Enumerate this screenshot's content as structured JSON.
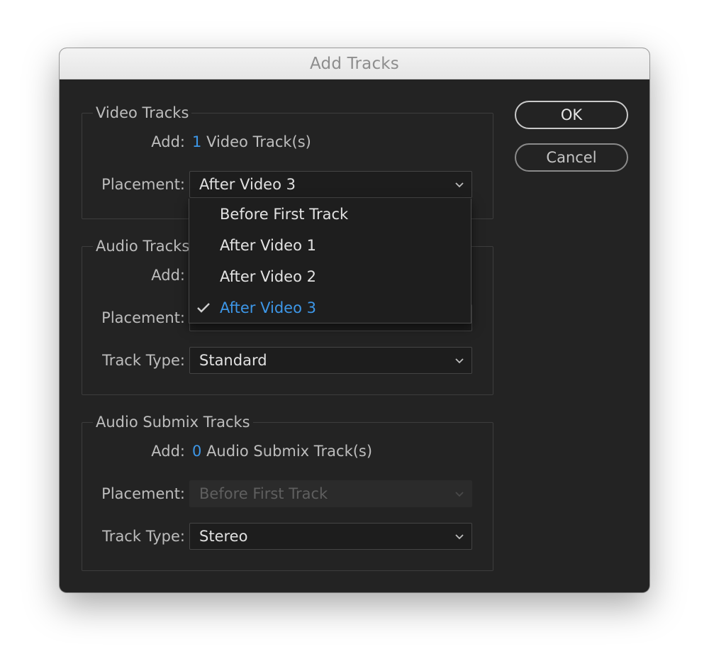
{
  "window": {
    "title": "Add Tracks"
  },
  "video": {
    "legend": "Video Tracks",
    "add_label": "Add:",
    "add_count": "1",
    "add_unit": "Video Track(s)",
    "placement_label": "Placement:",
    "placement_value": "After Video 3"
  },
  "audio": {
    "legend": "Audio Tracks",
    "add_label": "Add:",
    "placement_label": "Placement:",
    "track_type_label": "Track Type:",
    "track_type_value": "Standard"
  },
  "submix": {
    "legend": "Audio Submix Tracks",
    "add_label": "Add:",
    "add_count": "0",
    "add_unit": "Audio Submix Track(s)",
    "placement_label": "Placement:",
    "placement_value": "Before First Track",
    "placement_disabled": true,
    "track_type_label": "Track Type:",
    "track_type_value": "Stereo"
  },
  "buttons": {
    "ok": "OK",
    "cancel": "Cancel"
  },
  "dropdown": {
    "items": [
      {
        "label": "Before First Track",
        "selected": false
      },
      {
        "label": "After Video 1",
        "selected": false
      },
      {
        "label": "After Video 2",
        "selected": false
      },
      {
        "label": "After Video 3",
        "selected": true
      }
    ]
  },
  "colors": {
    "accent": "#3d97e8",
    "dialog_bg": "#232323",
    "text": "#bdbdbd"
  },
  "icons": {
    "select_arrow": "chevron-down-icon",
    "selected_mark": "checkmark-icon"
  }
}
